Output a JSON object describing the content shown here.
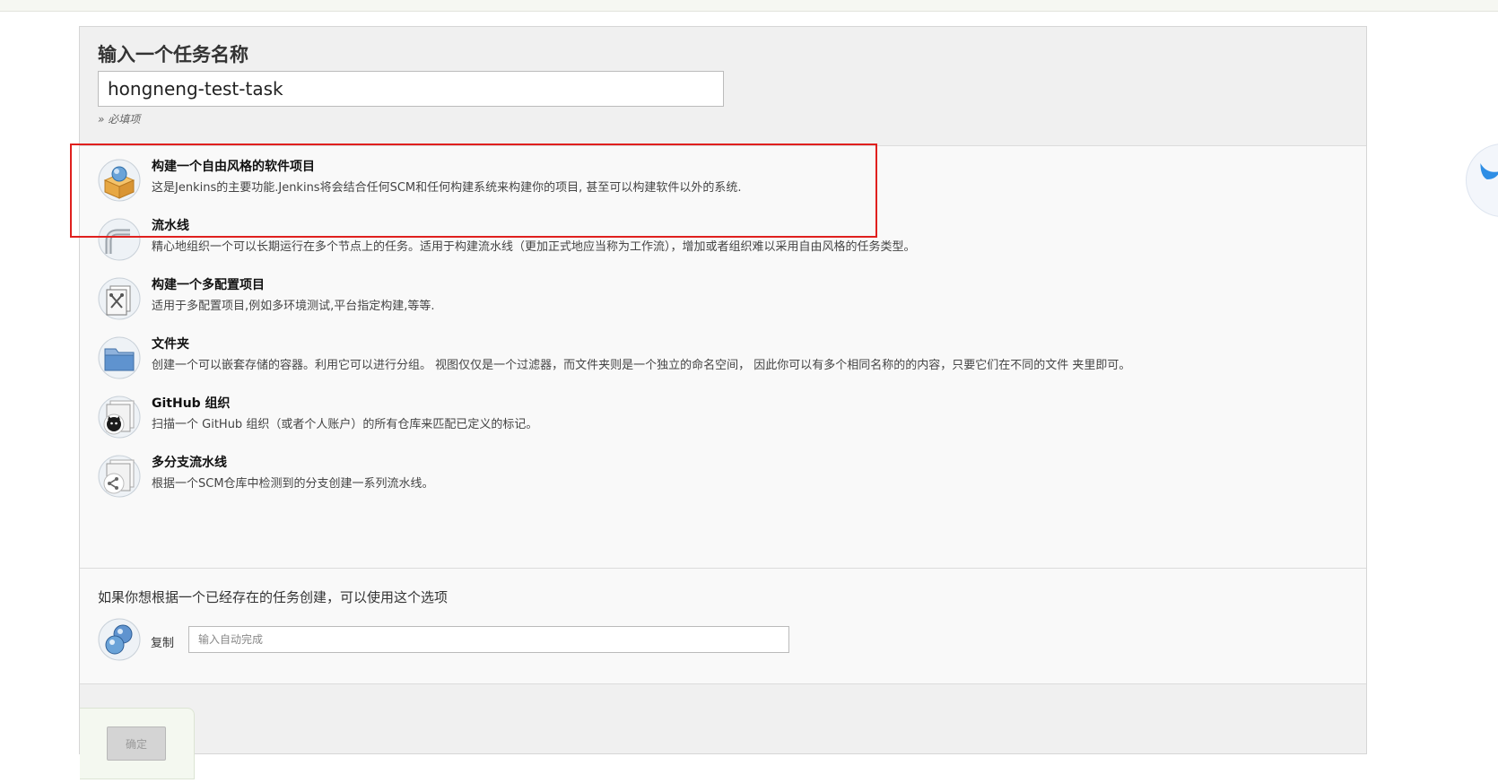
{
  "form": {
    "name_title": "输入一个任务名称",
    "name_value": "hongneng-test-task",
    "required_hint": "» 必填项"
  },
  "job_types": [
    {
      "label": "构建一个自由风格的软件项目",
      "description": "这是Jenkins的主要功能.Jenkins将会结合任何SCM和任何构建系统来构建你的项目, 甚至可以构建软件以外的系统.",
      "icon": "freestyle-box-icon"
    },
    {
      "label": "流水线",
      "description": "精心地组织一个可以长期运行在多个节点上的任务。适用于构建流水线（更加正式地应当称为工作流），增加或者组织难以采用自由风格的任务类型。",
      "icon": "pipeline-icon"
    },
    {
      "label": "构建一个多配置项目",
      "description": "适用于多配置项目,例如多环境测试,平台指定构建,等等.",
      "icon": "multi-config-icon"
    },
    {
      "label": "文件夹",
      "description": "创建一个可以嵌套存储的容器。利用它可以进行分组。 视图仅仅是一个过滤器，而文件夹则是一个独立的命名空间， 因此你可以有多个相同名称的的内容，只要它们在不同的文件 夹里即可。",
      "icon": "folder-icon"
    },
    {
      "label": "GitHub 组织",
      "description": "扫描一个 GitHub 组织（或者个人账户）的所有仓库来匹配已定义的标记。",
      "icon": "github-org-icon"
    },
    {
      "label": "多分支流水线",
      "description": "根据一个SCM仓库中检测到的分支创建一系列流水线。",
      "icon": "multibranch-icon"
    }
  ],
  "copy": {
    "title": "如果你想根据一个已经存在的任务创建，可以使用这个选项",
    "label": "复制",
    "placeholder": "输入自动完成"
  },
  "footer": {
    "ok_label": "确定"
  },
  "colors": {
    "highlight": "#e0201e",
    "panel_bg": "#f9f9f9",
    "header_bg": "#f0f0f0"
  }
}
